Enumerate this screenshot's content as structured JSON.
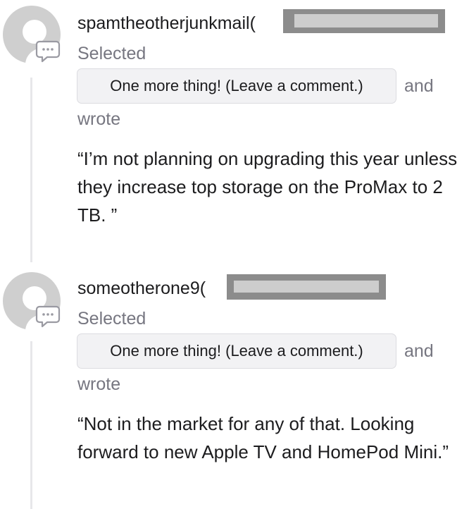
{
  "comments": [
    {
      "username": "spamtheotherjunkmail(",
      "selected_label": "Selected",
      "option_label": "One more thing! (Leave a comment.)",
      "and_label": "and",
      "wrote_label": "wrote",
      "quote": "“I’m not planning on upgrading this year unless they increase top storage on the ProMax to 2 TB. ”"
    },
    {
      "username": "someotherone9(",
      "selected_label": "Selected",
      "option_label": "One more thing! (Leave a comment.)",
      "and_label": "and",
      "wrote_label": "wrote",
      "quote": "“Not in the market for any of that. Looking forward to new Apple TV and HomePod Mini.”"
    }
  ],
  "icons": {
    "avatar": "default-user-avatar-icon",
    "comment": "comment-bubble-icon"
  },
  "colors": {
    "text": "#1c1c1e",
    "secondary_text": "#767680",
    "thread_line": "#e7e7ea",
    "chip_background": "#f2f2f4",
    "redaction": "#8c8c8c"
  }
}
